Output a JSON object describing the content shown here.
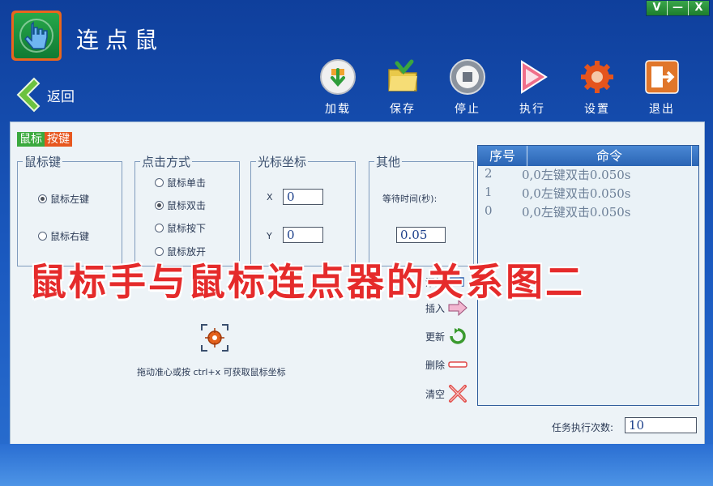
{
  "window": {
    "controls": [
      "V",
      "—",
      "X"
    ]
  },
  "app": {
    "title": "连点鼠"
  },
  "back_label": "返回",
  "toolbar": {
    "load": "加载",
    "save": "保存",
    "stop": "停止",
    "run": "执行",
    "settings": "设置",
    "exit": "退出"
  },
  "section_tag": {
    "part1": "鼠标",
    "part2": "按键"
  },
  "mouse_key": {
    "legend": "鼠标键",
    "left": "鼠标左键",
    "right": "鼠标右键"
  },
  "click_mode": {
    "legend": "点击方式",
    "single": "鼠标单击",
    "double": "鼠标双击",
    "press": "鼠标按下",
    "release": "鼠标放开"
  },
  "cursor": {
    "legend": "光标坐标",
    "x_label": "X",
    "x_value": "0",
    "y_label": "Y",
    "y_value": "0"
  },
  "other": {
    "legend": "其他",
    "wait_label": "等待时间(秒):",
    "wait_value": "0.05"
  },
  "crosshair_hint": "拖动准心或按 ctrl+x 可获取鼠标坐标",
  "list": {
    "headers": [
      "序号",
      "命令"
    ],
    "rows": [
      {
        "index": "2",
        "command": "0,0左键双击0.050s"
      },
      {
        "index": "1",
        "command": "0,0左键双击0.050s"
      },
      {
        "index": "0",
        "command": "0,0左键双击0.050s"
      }
    ]
  },
  "side_buttons": {
    "add": "添加",
    "insert": "插入",
    "update": "更新",
    "delete": "删除",
    "clear": "清空"
  },
  "task": {
    "label": "任务执行次数:",
    "value": "10"
  },
  "overlay_caption": "鼠标手与鼠标连点器的关系图二",
  "colors": {
    "title_bar": "#0f3f9c",
    "panel": "#edf3f7",
    "accent_green": "#1d7d2d",
    "overlay_red": "#e52b2b"
  }
}
